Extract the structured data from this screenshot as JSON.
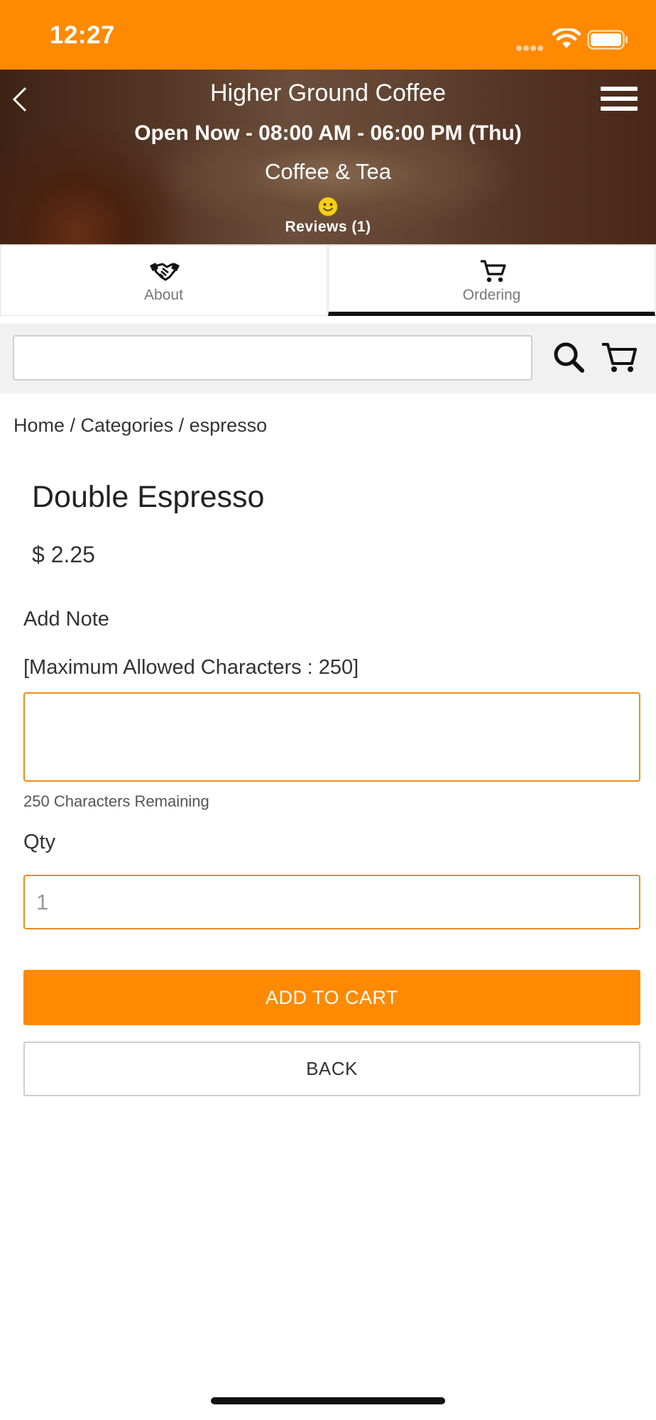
{
  "status_bar": {
    "time": "12:27"
  },
  "header": {
    "store_name": "Higher Ground Coffee",
    "hours": "Open Now - 08:00 AM - 06:00 PM (Thu)",
    "category": "Coffee & Tea",
    "reviews": "Reviews (1)"
  },
  "tabs": [
    {
      "label": "About",
      "icon": "handshake-icon",
      "active": false
    },
    {
      "label": "Ordering",
      "icon": "cart-icon",
      "active": true
    }
  ],
  "search": {
    "value": "",
    "placeholder": ""
  },
  "breadcrumb": "Home / Categories / espresso",
  "product": {
    "title": "Double Espresso",
    "price": "$ 2.25"
  },
  "note": {
    "label": "Add Note",
    "max_text": "[Maximum Allowed Characters : 250]",
    "value": "",
    "remaining_text": "250 Characters Remaining"
  },
  "qty": {
    "label": "Qty",
    "value": "1"
  },
  "buttons": {
    "add_to_cart": "ADD TO CART",
    "back": "BACK"
  },
  "colors": {
    "accent": "#ff8a00",
    "input_border": "#f08a1c",
    "active_tab": "#111111"
  }
}
